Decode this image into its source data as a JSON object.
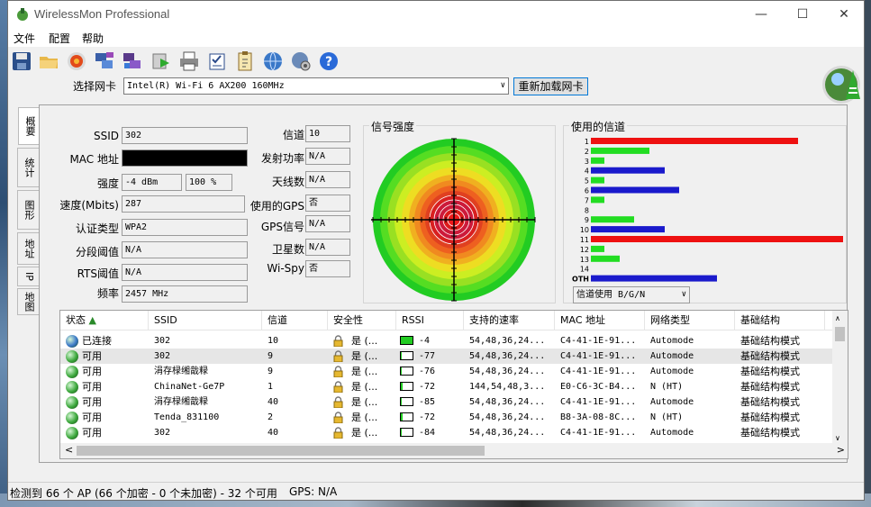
{
  "window": {
    "title": "WirelessMon Professional"
  },
  "menu": [
    "文件",
    "配置",
    "帮助"
  ],
  "toolbar": {
    "icons": [
      "save-icon",
      "open-folder-icon",
      "record-icon",
      "network-cards-icon",
      "network-cards-alt-icon",
      "run-icon",
      "print-icon",
      "checklist-icon",
      "clipboard-icon",
      "globe-icon",
      "settings-globe-icon",
      "help-icon"
    ]
  },
  "nic": {
    "label": "选择网卡",
    "selected": "Intel(R) Wi-Fi 6 AX200 160MHz",
    "reload_label": "重新加载网卡"
  },
  "side_tabs": [
    "概要",
    "统计",
    "图形",
    "地址",
    "IP",
    "地图"
  ],
  "summary": {
    "ssid_label": "SSID",
    "ssid": "302",
    "mac_label": "MAC 地址",
    "mac": "",
    "strength_label": "强度",
    "strength_dbm": "-4 dBm",
    "strength_pct": "100 %",
    "speed_label": "速度(Mbits)",
    "speed": "287",
    "auth_label": "认证类型",
    "auth": "WPA2",
    "frag_label": "分段阈值",
    "frag": "N/A",
    "rts_label": "RTS阈值",
    "rts": "N/A",
    "freq_label": "频率",
    "freq": "2457 MHz",
    "channel_label": "信道",
    "channel": "10",
    "txpower_label": "发射功率",
    "txpower": "N/A",
    "antenna_label": "天线数",
    "antenna": "N/A",
    "gps_used_label": "使用的GPS",
    "gps_used": "否",
    "gps_signal_label": "GPS信号",
    "gps_signal": "N/A",
    "satellites_label": "卫星数",
    "satellites": "N/A",
    "wispy_label": "Wi-Spy",
    "wispy": "否"
  },
  "signal": {
    "title": "信号强度"
  },
  "channels": {
    "title": "使用的信道",
    "select_value": "信道使用 B/G/N",
    "labels": [
      "1",
      "2",
      "3",
      "4",
      "5",
      "6",
      "7",
      "8",
      "9",
      "10",
      "11",
      "12",
      "13",
      "14",
      "OTH"
    ],
    "colors": {
      "red": "#ee1111",
      "green": "#22dd22",
      "blue": "#1a1acc"
    }
  },
  "table": {
    "columns": [
      "状态",
      "SSID",
      "信道",
      "安全性",
      "RSSI",
      "支持的速率",
      "MAC 地址",
      "网络类型",
      "基础结构"
    ],
    "rows": [
      {
        "status": "已连接",
        "ssid": "302",
        "channel": "10",
        "security": "是 (...",
        "rssi": "-4",
        "rates": "54,48,36,24...",
        "mac": "C4-41-1E-91...",
        "nettype": "Automode",
        "infra": "基础结构模式",
        "dot": "#3a78c8",
        "fill": 1.0
      },
      {
        "status": "可用",
        "ssid": "302",
        "channel": "9",
        "security": "是 (...",
        "rssi": "-77",
        "rates": "54,48,36,24...",
        "mac": "C4-41-1E-91...",
        "nettype": "Automode",
        "infra": "基础结构模式",
        "dot": "#3ca83c",
        "fill": 0.1
      },
      {
        "status": "可用",
        "ssid": "涓存椂缃戠粶",
        "channel": "9",
        "security": "是 (...",
        "rssi": "-76",
        "rates": "54,48,36,24...",
        "mac": "C4-41-1E-91...",
        "nettype": "Automode",
        "infra": "基础结构模式",
        "dot": "#3ca83c",
        "fill": 0.1
      },
      {
        "status": "可用",
        "ssid": "ChinaNet-Ge7P",
        "channel": "1",
        "security": "是 (...",
        "rssi": "-72",
        "rates": "144,54,48,3...",
        "mac": "E0-C6-3C-B4...",
        "nettype": "N (HT)",
        "infra": "基础结构模式",
        "dot": "#3ca83c",
        "fill": 0.15
      },
      {
        "status": "可用",
        "ssid": "涓存椂缃戠粶",
        "channel": "40",
        "security": "是 (...",
        "rssi": "-85",
        "rates": "54,48,36,24...",
        "mac": "C4-41-1E-91...",
        "nettype": "Automode",
        "infra": "基础结构模式",
        "dot": "#3ca83c",
        "fill": 0.05
      },
      {
        "status": "可用",
        "ssid": "Tenda_831100",
        "channel": "2",
        "security": "是 (...",
        "rssi": "-72",
        "rates": "54,48,36,24...",
        "mac": "B8-3A-08-8C...",
        "nettype": "N (HT)",
        "infra": "基础结构模式",
        "dot": "#3ca83c",
        "fill": 0.15
      },
      {
        "status": "可用",
        "ssid": "302",
        "channel": "40",
        "security": "是 (...",
        "rssi": "-84",
        "rates": "54,48,36,24...",
        "mac": "C4-41-1E-91...",
        "nettype": "Automode",
        "infra": "基础结构模式",
        "dot": "#3ca83c",
        "fill": 0.05
      }
    ]
  },
  "status": {
    "ap_text": "检测到 66 个 AP (66 个加密 - 0 个未加密) - 32 个可用",
    "gps_text": "GPS: N/A"
  },
  "chart_data": {
    "type": "bar",
    "title": "使用的信道",
    "categories": [
      "1",
      "2",
      "3",
      "4",
      "5",
      "6",
      "7",
      "8",
      "9",
      "10",
      "11",
      "12",
      "13",
      "14",
      "OTH"
    ],
    "series": [
      {
        "values": [
          0,
          0,
          0,
          0,
          0,
          0,
          0,
          0,
          0,
          0,
          0,
          0,
          0,
          0,
          0
        ]
      }
    ],
    "bars": [
      {
        "category": "1",
        "value": 230,
        "color": "red"
      },
      {
        "category": "2",
        "value": 65,
        "color": "green"
      },
      {
        "category": "3",
        "value": 15,
        "color": "green"
      },
      {
        "category": "4",
        "value": 82,
        "color": "blue"
      },
      {
        "category": "5",
        "value": 15,
        "color": "green"
      },
      {
        "category": "6",
        "value": 98,
        "color": "blue"
      },
      {
        "category": "7",
        "value": 15,
        "color": "green"
      },
      {
        "category": "8",
        "value": 0,
        "color": "green"
      },
      {
        "category": "9",
        "value": 48,
        "color": "green"
      },
      {
        "category": "10",
        "value": 82,
        "color": "blue"
      },
      {
        "category": "11",
        "value": 280,
        "color": "red"
      },
      {
        "category": "12",
        "value": 15,
        "color": "green"
      },
      {
        "category": "13",
        "value": 32,
        "color": "green"
      },
      {
        "category": "14",
        "value": 0,
        "color": "green"
      },
      {
        "category": "OTH",
        "value": 140,
        "color": "blue"
      }
    ]
  }
}
